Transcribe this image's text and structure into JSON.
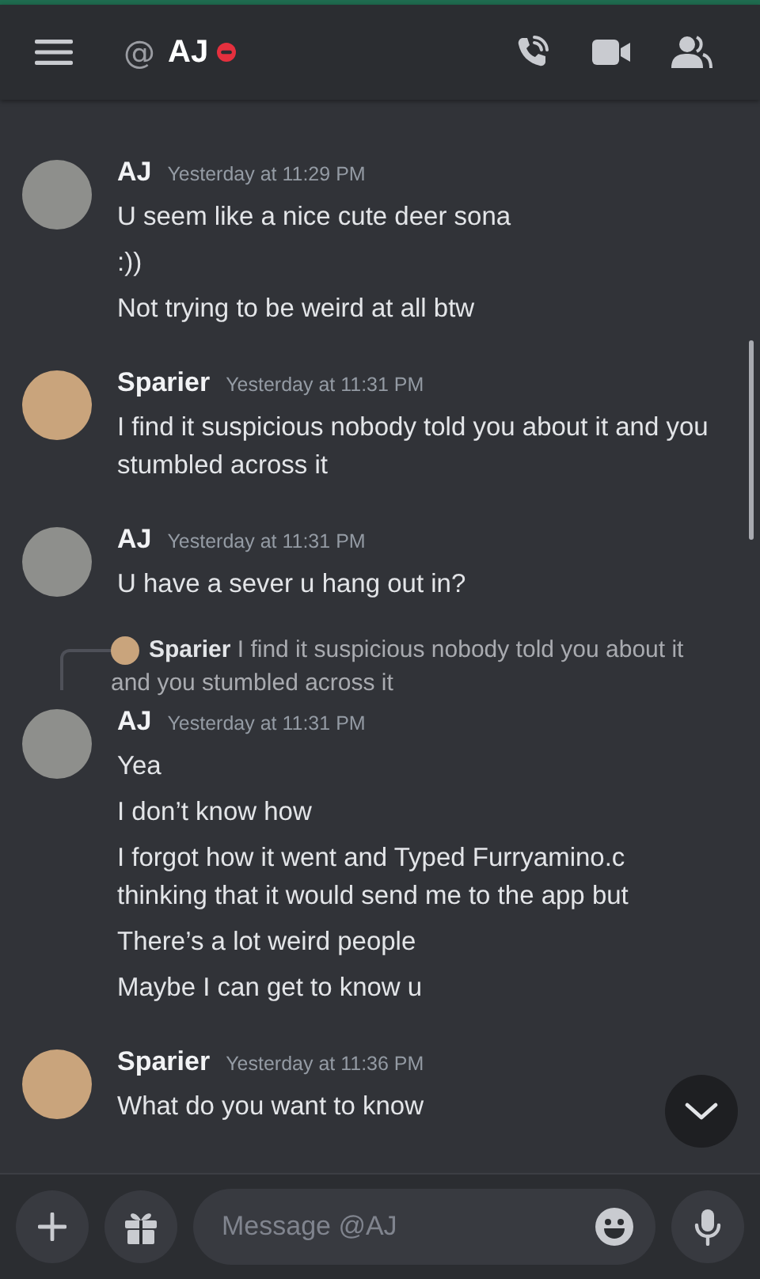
{
  "header": {
    "at_symbol": "@",
    "title": "AJ",
    "do_not_disturb": true
  },
  "messages": [
    {
      "author": "AJ",
      "time": "Yesterday at 11:29 PM",
      "avatar": {
        "kind": "sketch"
      },
      "lines": [
        "U seem like a nice cute deer sona",
        ":))",
        "Not trying to be weird at all btw"
      ]
    },
    {
      "author": "Sparier",
      "time": "Yesterday at 11:31 PM",
      "avatar": {
        "kind": "photo"
      },
      "lines": [
        "I find it suspicious nobody told you about it and you stumbled across it"
      ]
    },
    {
      "author": "AJ",
      "time": "Yesterday at 11:31 PM",
      "avatar": {
        "kind": "sketch"
      },
      "lines": [
        "U have a sever u hang out in?"
      ]
    },
    {
      "author": "AJ",
      "time": "Yesterday at 11:31 PM",
      "avatar": {
        "kind": "sketch"
      },
      "reply": {
        "author": "Sparier",
        "avatar": {
          "kind": "photo"
        },
        "text": "I find it suspicious nobody told you about it and you stumbled across it"
      },
      "lines": [
        "Yea",
        "I don’t know how",
        "I forgot how it went and Typed Furryamino.c thinking that it would send me to the app but",
        "There’s a lot weird people",
        "Maybe I can get to know u"
      ]
    },
    {
      "author": "Sparier",
      "time": "Yesterday at 11:36 PM",
      "avatar": {
        "kind": "photo"
      },
      "lines": [
        "What do you want to know"
      ]
    }
  ],
  "composer": {
    "placeholder": "Message @AJ"
  }
}
